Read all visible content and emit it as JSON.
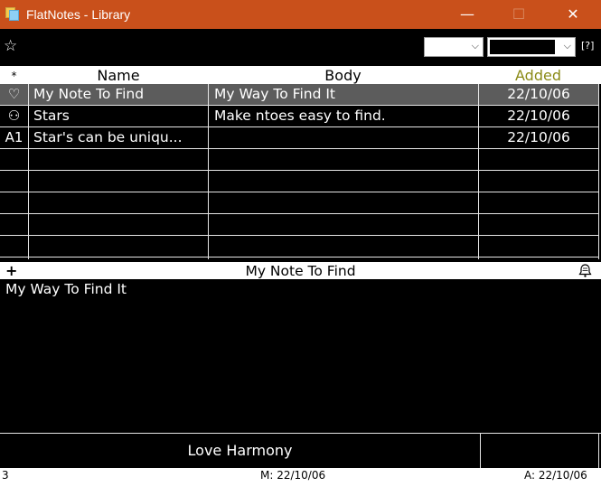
{
  "window": {
    "title": "FlatNotes - Library",
    "minimize_glyph": "—",
    "maximize_glyph": "☐",
    "close_glyph": "✕"
  },
  "toolbar": {
    "star_filter_icon": "star-outline-icon",
    "star_glyph": "☆",
    "help_label": "[?]",
    "select1_value": "",
    "select2_value": "",
    "chevron_glyph": "⌵"
  },
  "table": {
    "headers": {
      "star": "*",
      "name": "Name",
      "body": "Body",
      "added": "Added"
    },
    "rows": [
      {
        "icon": "♡",
        "icon_name": "heart-icon",
        "name": "My Note To Find",
        "body": "My Way To Find It",
        "added": "22/10/06",
        "selected": true
      },
      {
        "icon": "⚇",
        "icon_name": "heart-face-icon",
        "name": "Stars",
        "body": "Make ntoes easy to find.",
        "added": "22/10/06",
        "selected": false
      },
      {
        "icon": "A1",
        "icon_name": "",
        "name": "Star's can be uniqu...",
        "body": "",
        "added": "22/10/06",
        "selected": false
      }
    ],
    "empty_row_count": 5
  },
  "note": {
    "add_glyph": "+",
    "title": "My Note To Find",
    "body": "My Way To Find It"
  },
  "tag": {
    "label": "Love Harmony"
  },
  "status": {
    "count": "3",
    "modified": "M: 22/10/06",
    "added": "A: 22/10/06"
  },
  "colors": {
    "titlebar": "#c9501b",
    "selected_row": "#5c5c5c",
    "added_header": "#8a8a16"
  }
}
